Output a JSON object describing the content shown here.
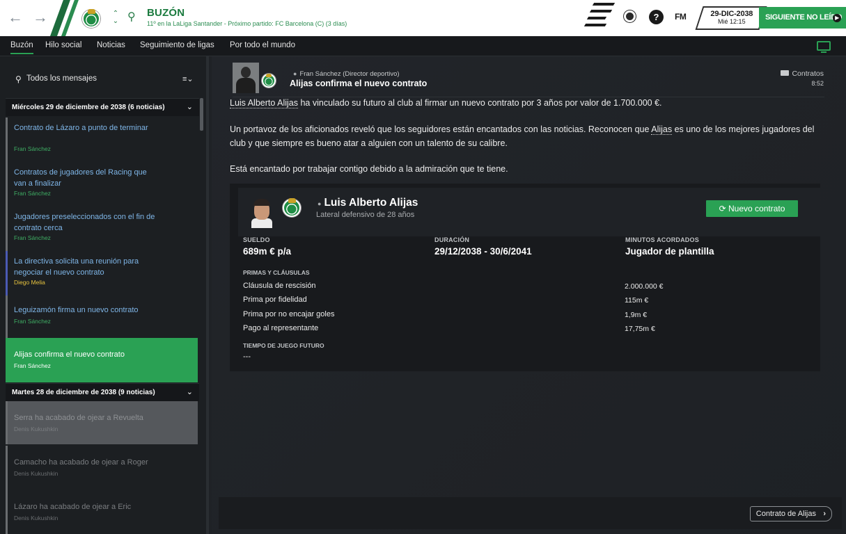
{
  "header": {
    "title": "BUZÓN",
    "subtitle": "11º en la LaLiga Santander - Próximo partido: FC Barcelona (C) (3 días)",
    "fm_label": "FM",
    "date": "29-DIC-2038",
    "weekday_time": "Mié 12:15",
    "next_button": "SIGUIENTE NO LEÍDO",
    "help": "?"
  },
  "tabs": [
    {
      "label": "Buzón"
    },
    {
      "label": "Hilo social"
    },
    {
      "label": "Noticias"
    },
    {
      "label": "Seguimiento de ligas"
    },
    {
      "label": "Por todo el mundo"
    }
  ],
  "sidebar": {
    "search_label": "Todos los mensajes",
    "filter_icon": "≡⌄",
    "days": [
      {
        "label": "Miércoles 29 de diciembre de 2038 (6 noticias)"
      },
      {
        "label": "Martes 28 de diciembre de 2038 (9 noticias)"
      }
    ],
    "messages": [
      {
        "title": "Contrato de Lázaro a punto de terminar",
        "from": "Fran Sánchez"
      },
      {
        "title": "Contratos de jugadores del Racing que van a finalizar",
        "from": "Fran Sánchez"
      },
      {
        "title": "Jugadores preseleccionados con el fin de contrato cerca",
        "from": "Fran Sánchez"
      },
      {
        "title": "La directiva solicita una reunión para negociar el nuevo contrato",
        "from": "Diego Melia"
      },
      {
        "title": "Leguizamón firma un nuevo contrato",
        "from": "Fran Sánchez"
      },
      {
        "title": "Alijas confirma el nuevo contrato",
        "from": "Fran Sánchez"
      },
      {
        "title": "Serra ha acabado de ojear a Revuelta",
        "from": "Denis Kukushkin"
      },
      {
        "title": "Camacho ha acabado de ojear a Roger",
        "from": "Denis Kukushkin"
      },
      {
        "title": "Lázaro ha acabado de ojear a Eric",
        "from": "Denis Kukushkin"
      }
    ]
  },
  "message": {
    "sender": "Fran Sánchez  (Director deportivo)",
    "subject": "Alijas confirma el nuevo contrato",
    "tag": "Contratos",
    "time": "8:52",
    "p1_name": "Luis Alberto Alijas",
    "p1_rest": " ha vinculado su futuro al club al firmar un nuevo contrato por 3 años por valor de 1.700.000 €.",
    "p2_a": "Un portavoz de los aficionados reveló que los seguidores están encantados con las noticias. Reconocen que ",
    "p2_name": "Alijas",
    "p2_b": " es uno de los mejores jugadores del club y que siempre es bueno atar a alguien con un talento de su calibre.",
    "p3": "Está encantado por trabajar contigo debido a la admiración que te tiene."
  },
  "contract": {
    "player_name": "Luis Alberto Alijas",
    "player_role": "Lateral defensivo de 28 años",
    "new_contract_button": "Nuevo contrato",
    "salary_label": "SUELDO",
    "salary_value": "689m € p/a",
    "duration_label": "DURACIÓN",
    "duration_value": "29/12/2038 - 30/6/2041",
    "minutes_label": "MINUTOS ACORDADOS",
    "minutes_value": "Jugador de plantilla",
    "bonuses_label": "PRIMAS Y CLÁUSULAS",
    "bonuses": [
      {
        "label": "Cláusula de rescisión",
        "value": "2.000.000 €"
      },
      {
        "label": "Prima por fidelidad",
        "value": "115m €"
      },
      {
        "label": "Prima por no encajar goles",
        "value": "1,9m €"
      },
      {
        "label": "Pago al representante",
        "value": "17,75m €"
      }
    ],
    "future_label": "TIEMPO DE JUEGO FUTURO",
    "future_value": "---"
  },
  "footer": {
    "contract_button": "Contrato de Alijas",
    "arrow": "›"
  },
  "colors": {
    "accent": "#2aa154",
    "link": "#7fb6e8",
    "background": "#1f2226"
  }
}
